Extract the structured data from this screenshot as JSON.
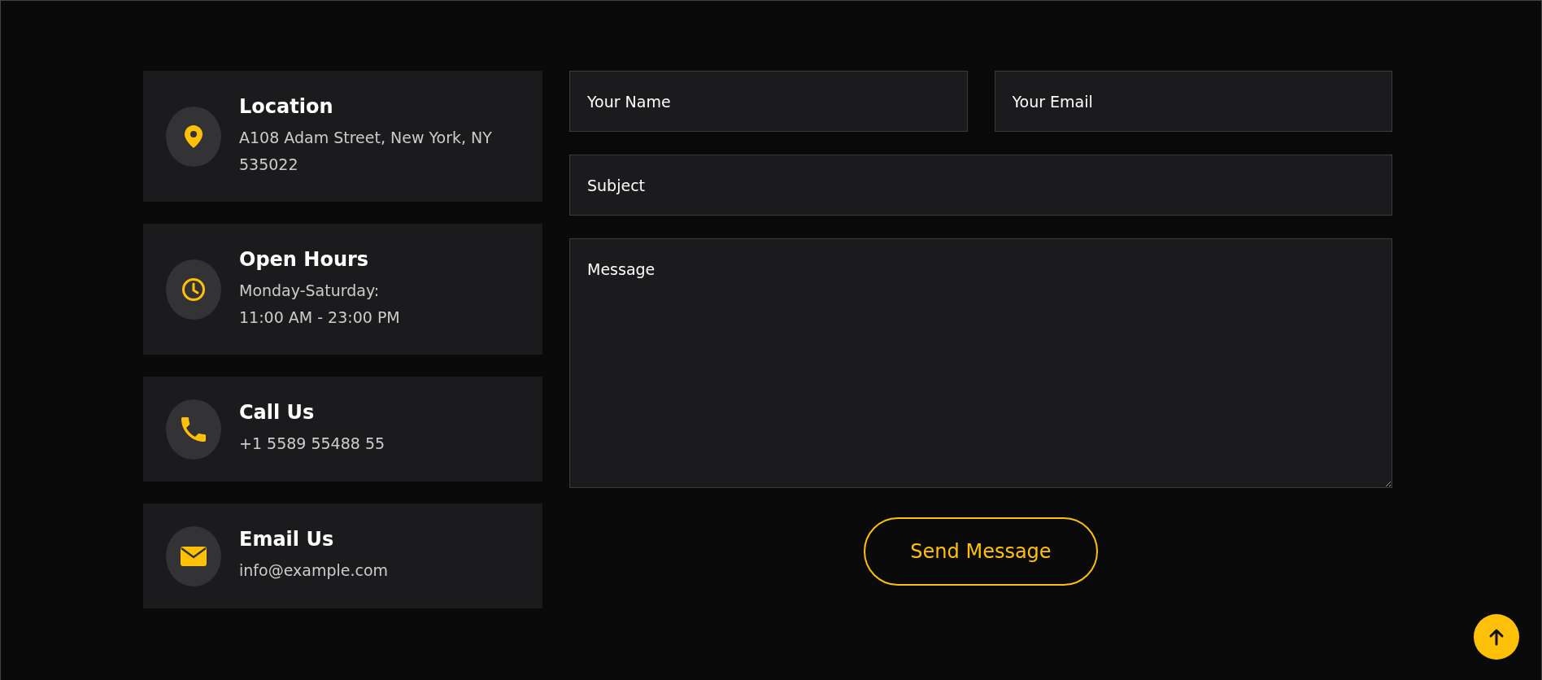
{
  "contact_cards": [
    {
      "kind": "location",
      "title": "Location",
      "text": "A108 Adam Street, New York, NY 535022"
    },
    {
      "kind": "hours",
      "title": "Open Hours",
      "text": "Monday-Saturday:\n11:00 AM - 23:00 PM"
    },
    {
      "kind": "call",
      "title": "Call Us",
      "text": "+1 5589 55488 55"
    },
    {
      "kind": "email",
      "title": "Email Us",
      "text": "info@example.com"
    }
  ],
  "form": {
    "name": {
      "placeholder": "Your Name"
    },
    "email": {
      "placeholder": "Your Email"
    },
    "subject": {
      "placeholder": "Subject"
    },
    "message": {
      "placeholder": "Message"
    },
    "submit": "Send Message"
  }
}
